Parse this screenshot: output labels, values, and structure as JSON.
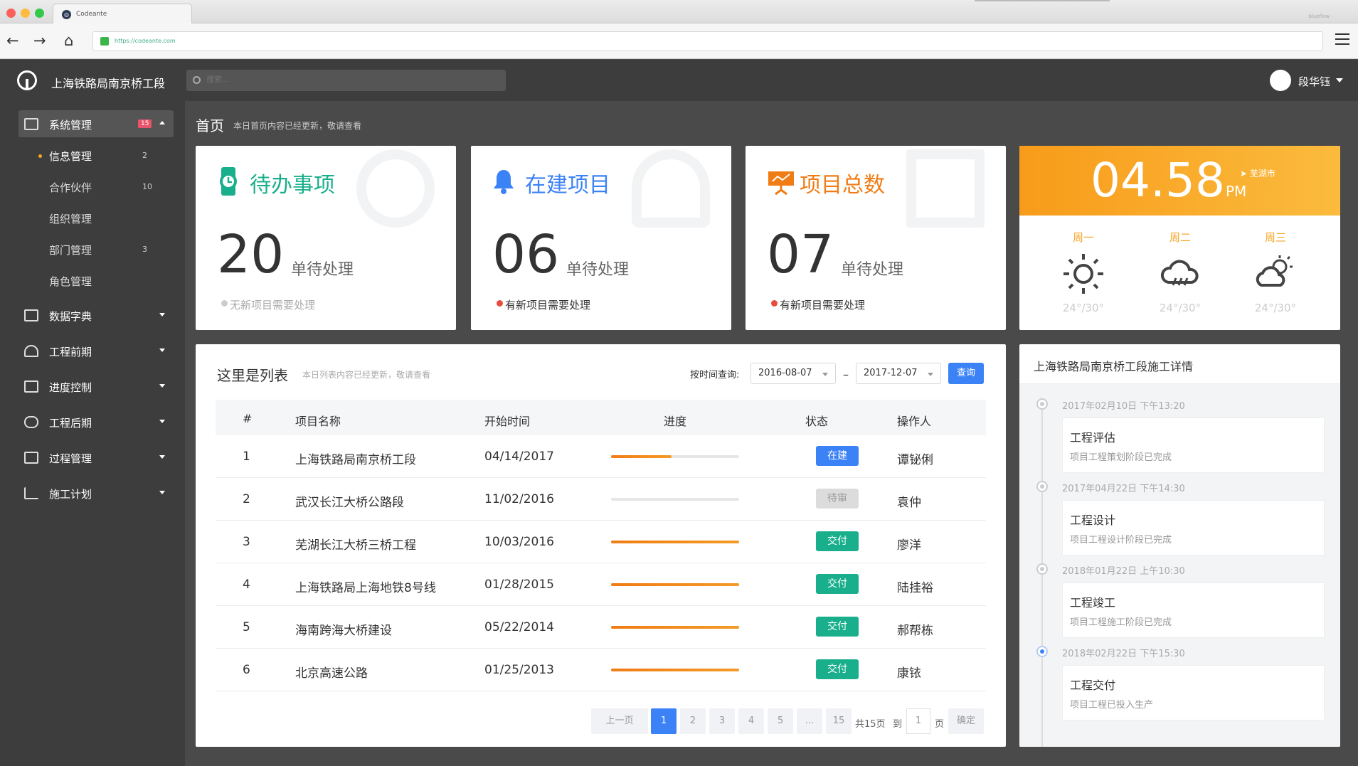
{
  "browser": {
    "tab_title": "Codeante",
    "url": "https://codeante.com",
    "profile": "blueflow"
  },
  "header": {
    "app_title": "上海铁路局南京桥工段",
    "search_placeholder": "搜索...",
    "user_name": "段华钰"
  },
  "sidebar": {
    "items": [
      {
        "label": "系统管理",
        "badge": "15"
      },
      {
        "label": "数据字典"
      },
      {
        "label": "工程前期"
      },
      {
        "label": "进度控制"
      },
      {
        "label": "工程后期"
      },
      {
        "label": "过程管理"
      },
      {
        "label": "施工计划"
      }
    ],
    "subitems": [
      {
        "label": "信息管理",
        "count": "2"
      },
      {
        "label": "合作伙伴",
        "count": "10"
      },
      {
        "label": "组织管理",
        "count": ""
      },
      {
        "label": "部门管理",
        "count": "3"
      },
      {
        "label": "角色管理",
        "count": ""
      }
    ]
  },
  "page": {
    "title": "首页",
    "subtitle": "本日首页内容已经更新，敬请查看"
  },
  "cards": [
    {
      "title": "待办事项",
      "number": "20",
      "number_label": "单待处理",
      "note": "无新项目需要处理",
      "color": "#1aaf8c"
    },
    {
      "title": "在建项目",
      "number": "06",
      "number_label": "单待处理",
      "note": "有新项目需要处理",
      "color": "#3b82f6"
    },
    {
      "title": "项目总数",
      "number": "07",
      "number_label": "单待处理",
      "note": "有新项目需要处理",
      "color": "#f07c14"
    }
  ],
  "weather": {
    "time": "04.58",
    "ampm": "PM",
    "city": "芜湖市",
    "days": [
      {
        "day": "周一",
        "icon": "sun-icon",
        "temp": "24°/30°"
      },
      {
        "day": "周二",
        "icon": "rain-cloud-icon",
        "temp": "24°/30°"
      },
      {
        "day": "周三",
        "icon": "partly-cloudy-icon",
        "temp": "24°/30°"
      }
    ]
  },
  "list": {
    "title": "这里是列表",
    "subtitle": "本日列表内容已经更新，敬请查看",
    "query_label": "按时间查询:",
    "date_from": "2016-08-07",
    "date_sep": "–",
    "date_to": "2017-12-07",
    "query_button": "查询",
    "columns": [
      "#",
      "项目名称",
      "开始时间",
      "进度",
      "状态",
      "操作人"
    ],
    "rows": [
      {
        "id": "1",
        "name": "上海铁路局南京桥工段",
        "start": "04/14/2017",
        "progress": 0.47,
        "status": "在建",
        "status_color": "#3b82f6",
        "operator": "谭铋俐"
      },
      {
        "id": "2",
        "name": "武汉长江大桥公路段",
        "start": "11/02/2016",
        "progress": 0,
        "status": "待审",
        "status_color": "#dcdcdc",
        "operator": "袁仲"
      },
      {
        "id": "3",
        "name": "芜湖长江大桥三桥工程",
        "start": "10/03/2016",
        "progress": 1,
        "status": "交付",
        "status_color": "#1aaf8c",
        "operator": "廖洋"
      },
      {
        "id": "4",
        "name": "上海铁路局上海地铁8号线",
        "start": "01/28/2015",
        "progress": 1,
        "status": "交付",
        "status_color": "#1aaf8c",
        "operator": "陆挂裕"
      },
      {
        "id": "5",
        "name": "海南跨海大桥建设",
        "start": "05/22/2014",
        "progress": 1,
        "status": "交付",
        "status_color": "#1aaf8c",
        "operator": "郝帮栋"
      },
      {
        "id": "6",
        "name": "北京高速公路",
        "start": "01/25/2013",
        "progress": 1,
        "status": "交付",
        "status_color": "#1aaf8c",
        "operator": "康铱"
      }
    ],
    "pagination": {
      "prev": "上一页",
      "pages": [
        "1",
        "2",
        "3",
        "4",
        "5",
        "…",
        "15"
      ],
      "current": "1",
      "total": "共15页",
      "goto_label": "到",
      "goto_value": "1",
      "page_unit": "页",
      "confirm": "确定"
    }
  },
  "timeline": {
    "title": "上海铁路局南京桥工段施工详情",
    "events": [
      {
        "date": "2017年02月10日 下午13:20",
        "title": "工程评估",
        "desc": "项目工程策划阶段已完成"
      },
      {
        "date": "2017年04月22日 下午14:30",
        "title": "工程设计",
        "desc": "项目工程设计阶段已完成"
      },
      {
        "date": "2018年01月22日 上午10:30",
        "title": "工程竣工",
        "desc": "项目工程施工阶段已完成"
      },
      {
        "date": "2018年02月22日 下午15:30",
        "title": "工程交付",
        "desc": "项目工程已投入生产"
      }
    ]
  }
}
